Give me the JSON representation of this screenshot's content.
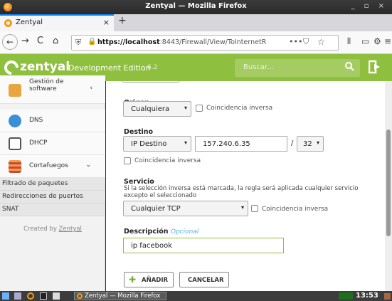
{
  "window": {
    "title": "Zentyal — Mozilla Firefox",
    "controls": "_ ▫ ×"
  },
  "tab": {
    "label": "Zentyal",
    "close": "×",
    "new_tab": "+"
  },
  "nav": {
    "back": "←",
    "forward": "→",
    "reload": "C",
    "home": "⌂",
    "url_host": "https://localhost",
    "url_rest": ":8443/Firewall/View/ToInternetR",
    "page_actions": "•••",
    "pocket": "⛉",
    "bookmark": "☆",
    "library": "⫴",
    "sidebar_toggle": "▭",
    "extension": "⚙",
    "menu": "≡"
  },
  "header": {
    "brand": "zentyal",
    "edition": "Development Edition",
    "version": "6.2",
    "search_placeholder": "Buscar...",
    "search_icon": "🔍",
    "logout_icon": "⇥"
  },
  "sidebar": {
    "items": [
      {
        "label": "Gestión de\nsoftware",
        "chevron": "‹"
      },
      {
        "label": "DNS"
      },
      {
        "label": "DHCP"
      },
      {
        "label": "Cortafuegos",
        "chevron": "⌄"
      }
    ],
    "subitems": [
      "Filtrado de paquetes",
      "Redirecciones de puertos",
      "SNAT"
    ],
    "created_by_prefix": "Created by ",
    "created_by_link": "Zentyal"
  },
  "form": {
    "origen": {
      "label": "Origen",
      "value": "Cualquiera",
      "inverse_label": "Coincidencia inversa"
    },
    "destino": {
      "label": "Destino",
      "value": "IP Destino",
      "ip": "157.240.6.35",
      "slash": "/",
      "mask": "32",
      "inverse_label": "Coincidencia inversa"
    },
    "servicio": {
      "label": "Servicio",
      "help": "Si la selección inversa está marcada, la regla será aplicada cualquier servicio excepto el seleccionado",
      "value": "Cualquier TCP",
      "inverse_label": "Coincidencia inversa"
    },
    "descripcion": {
      "label": "Descripción",
      "optional": "Opcional",
      "value": "ip facebook"
    },
    "add_button": "AÑADIR",
    "add_icon": "✚",
    "cancel_button": "CANCELAR"
  },
  "taskbar": {
    "task_label": "Zentyal — Mozilla Firefox",
    "clock": "13:53"
  }
}
